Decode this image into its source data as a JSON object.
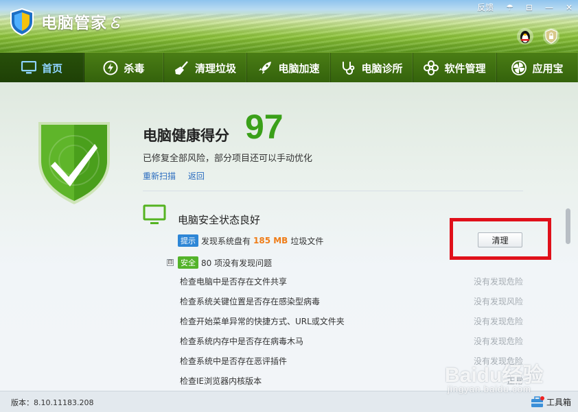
{
  "app": {
    "title": "电脑管家",
    "title_deco": "Ꮛ"
  },
  "window_controls": {
    "feedback": "反馈",
    "skin": "☂",
    "menu": "⊟",
    "minimize": "—",
    "close": "✕"
  },
  "nav": [
    {
      "label": "首页",
      "icon": "monitor-icon"
    },
    {
      "label": "杀毒",
      "icon": "lightning-icon"
    },
    {
      "label": "清理垃圾",
      "icon": "broom-icon"
    },
    {
      "label": "电脑加速",
      "icon": "rocket-icon"
    },
    {
      "label": "电脑诊所",
      "icon": "stethoscope-icon"
    },
    {
      "label": "软件管理",
      "icon": "flower-icon"
    },
    {
      "label": "应用宝",
      "icon": "pinwheel-icon"
    }
  ],
  "health": {
    "title": "电脑健康得分",
    "score": "97",
    "subtitle": "已修复全部风险，部分项目还可以手动优化",
    "rescan": "重新扫描",
    "back": "返回"
  },
  "security": {
    "title": "电脑安全状态良好",
    "tip_badge": "提示",
    "tip_prefix": "发现系统盘有",
    "tip_size": "185 MB",
    "tip_suffix": "垃圾文件",
    "clean_button": "清理",
    "safe_toggle": "⊟",
    "safe_badge": "安全",
    "safe_text": "80 项没有发现问题"
  },
  "checks": [
    {
      "label": "检查电脑中是否存在文件共享",
      "result": "没有发现危险"
    },
    {
      "label": "检查系统关键位置是否存在感染型病毒",
      "result": "没有发现风险"
    },
    {
      "label": "检查开始菜单异常的快捷方式、URL或文件夹",
      "result": "没有发现危险"
    },
    {
      "label": "检查系统内存中是否存在病毒木马",
      "result": "没有发现危险"
    },
    {
      "label": "检查系统中是否存在恶评插件",
      "result": "没有发现危险"
    },
    {
      "label": "检查IE浏览器内核版本",
      "result": "正常"
    }
  ],
  "status": {
    "version": "版本：8.10.11183.208",
    "toolbox": "工具箱"
  },
  "watermark": {
    "logo": "Baidu经验",
    "url": "jingyan.baidu.com"
  },
  "colors": {
    "score": "#3aa019",
    "nav_bg": "#34620c",
    "active_nav_text": "#8fd4ff",
    "highlight_box": "#e0101a",
    "junk_size": "#ef7c17"
  }
}
